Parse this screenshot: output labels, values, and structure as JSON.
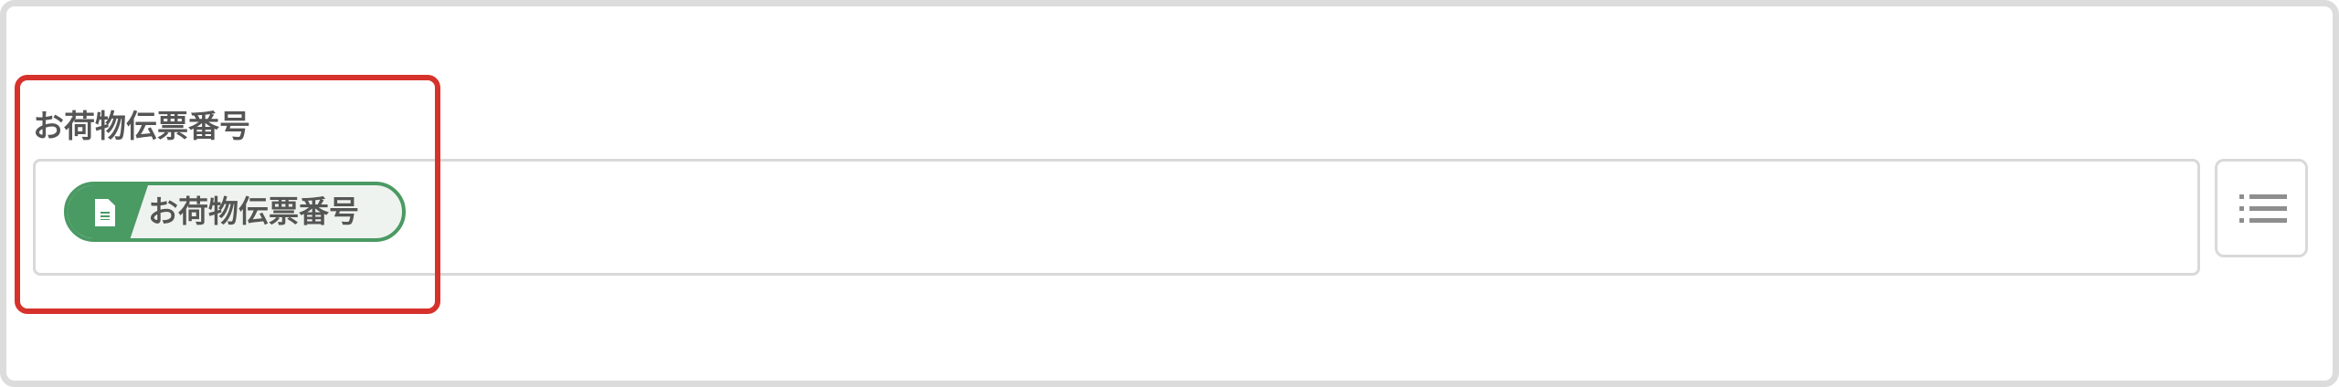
{
  "field": {
    "label": "お荷物伝票番号",
    "chip_label": "お荷物伝票番号"
  },
  "colors": {
    "chip_accent": "#4a9a63",
    "highlight": "#d6322b",
    "border": "#d9d9d9",
    "text": "#555555"
  },
  "icons": {
    "chip_icon": "spreadsheet-doc-icon",
    "list_button_icon": "list-icon"
  }
}
